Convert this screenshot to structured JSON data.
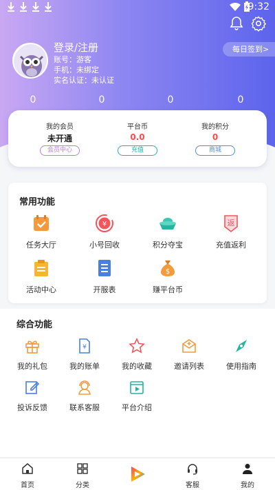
{
  "status_bar": {
    "time": "9:32"
  },
  "profile": {
    "login_label": "登录/注册",
    "account": "账号：游客",
    "phone": "手机：未绑定",
    "realname": "实名认证：未认证",
    "daily_signin": "每日签到>"
  },
  "stats": [
    "0",
    "0",
    "0",
    "0"
  ],
  "wallet": [
    {
      "label": "我的会员",
      "value": "未开通",
      "button": "会员中心",
      "value_color": "#222222",
      "button_color": "#c07ae6"
    },
    {
      "label": "平台币",
      "value": "0.0",
      "button": "充值",
      "value_color": "#ff4a4a",
      "button_color": "#28b3a8"
    },
    {
      "label": "我的积分",
      "value": "0",
      "button": "商城",
      "value_color": "#ff4a4a",
      "button_color": "#4a90e2"
    }
  ],
  "common": {
    "title": "常用功能",
    "items": [
      {
        "label": "任务大厅",
        "icon": "calendar-check-icon"
      },
      {
        "label": "小号回收",
        "icon": "yuan-recycle-icon"
      },
      {
        "label": "积分夺宝",
        "icon": "gold-ingot-icon"
      },
      {
        "label": "充值返利",
        "icon": "rebate-icon"
      },
      {
        "label": "活动中心",
        "icon": "activity-board-icon"
      },
      {
        "label": "开服表",
        "icon": "server-list-icon"
      },
      {
        "label": "赚平台币",
        "icon": "money-bag-icon"
      }
    ]
  },
  "general": {
    "title": "综合功能",
    "items": [
      {
        "label": "我的礼包",
        "icon": "gift-icon"
      },
      {
        "label": "我的账单",
        "icon": "bill-icon"
      },
      {
        "label": "我的收藏",
        "icon": "star-icon"
      },
      {
        "label": "邀请列表",
        "icon": "invite-mail-icon"
      },
      {
        "label": "使用指南",
        "icon": "compass-icon"
      },
      {
        "label": "投诉反馈",
        "icon": "edit-icon"
      },
      {
        "label": "联系客服",
        "icon": "customer-service-icon"
      },
      {
        "label": "平台介绍",
        "icon": "video-icon"
      }
    ]
  },
  "tabs": [
    {
      "label": "首页",
      "icon": "home-icon"
    },
    {
      "label": "分类",
      "icon": "category-icon"
    },
    {
      "label": "",
      "icon": "play-logo-icon"
    },
    {
      "label": "客服",
      "icon": "headset-icon"
    },
    {
      "label": "我的",
      "icon": "person-icon"
    }
  ],
  "colors": {
    "header_gradient_start": "#c9a8f3",
    "header_gradient_end": "#5d64ec",
    "orange_icon": "#f39a3c",
    "red_icon": "#f2555a",
    "blue_icon": "#4a7fe0",
    "teal_icon": "#25b4a0"
  }
}
